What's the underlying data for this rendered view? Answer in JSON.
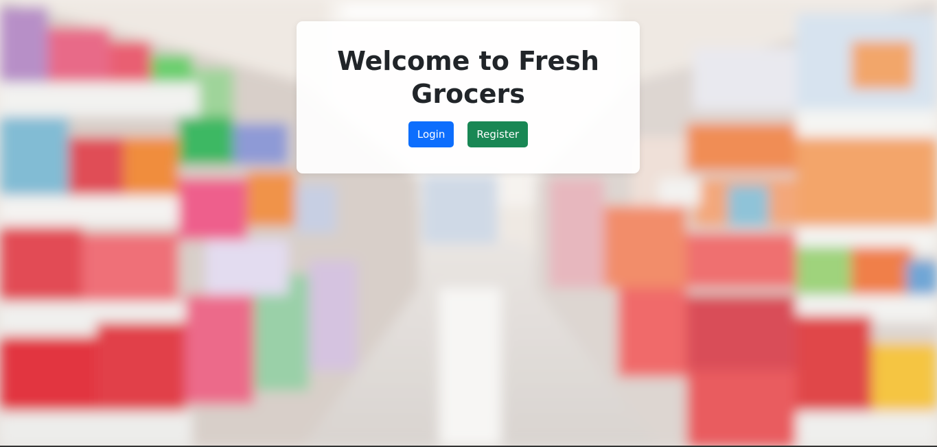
{
  "hero": {
    "title": "Welcome to Fresh Grocers"
  },
  "actions": {
    "login_label": "Login",
    "register_label": "Register"
  },
  "colors": {
    "login_button": "#0d6efd",
    "register_button": "#198754",
    "card_background": "#ffffff",
    "title_text": "#212529"
  }
}
